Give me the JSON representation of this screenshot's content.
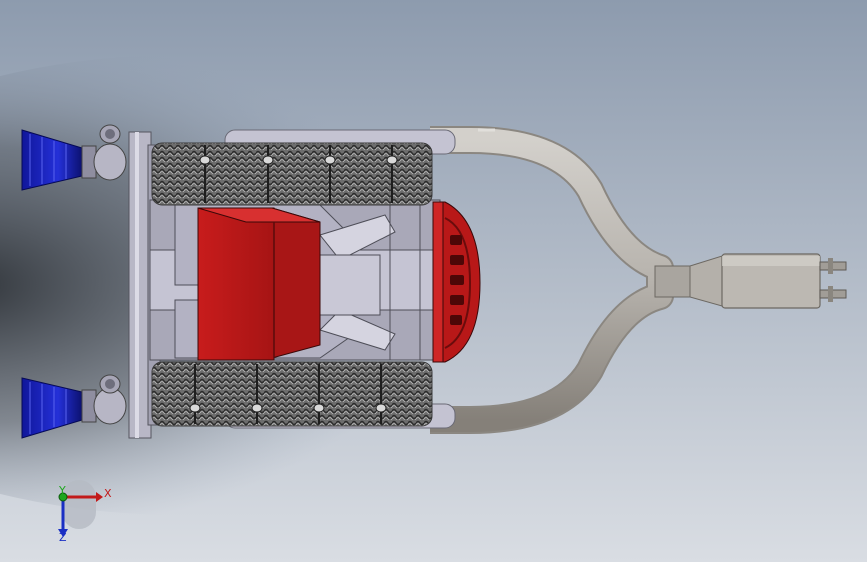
{
  "scene": {
    "description_free": true,
    "background": {
      "top_color": "#8d9bae",
      "bottom_color": "#d9dde3",
      "shadow_color": "#2a2e33"
    },
    "colors": {
      "filter_blue": "#1a22c8",
      "filter_blue_dark": "#0c1170",
      "housing_red": "#c41a1a",
      "housing_red_dark": "#8f0f0f",
      "metal_light": "#c9c8d6",
      "metal_mid": "#a7a6b6",
      "metal_dark": "#5a5a66",
      "pipe_gray": "#b7b3ad",
      "pipe_gray_dark": "#7f7b76",
      "coil_dark": "#3a3a3a",
      "coil_light": "#9a9a9a"
    }
  },
  "axis_triad": {
    "x_label": "X",
    "y_label": "Y",
    "z_label": "Z",
    "x_color": "#c21a1a",
    "y_color": "#1fa61f",
    "z_color": "#1a2fc4"
  }
}
